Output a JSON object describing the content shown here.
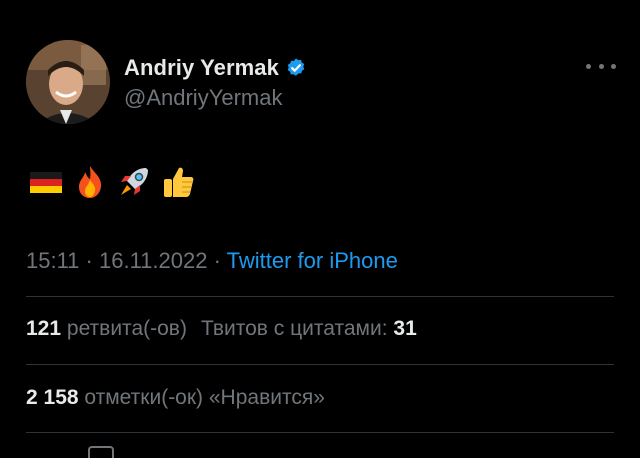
{
  "tweet": {
    "author": {
      "display_name": "Andriy Yermak",
      "handle": "@AndriyYermak",
      "verified": true
    },
    "emojis": [
      "german-flag",
      "fire",
      "rocket",
      "thumbs-up"
    ],
    "meta": {
      "time": "15:11",
      "date": "16.11.2022",
      "separator": "·",
      "source": "Twitter for iPhone"
    },
    "stats": {
      "retweets_count": "121",
      "retweets_label": "ретвита(-ов)",
      "quotes_label": "Твитов с цитатами:",
      "quotes_count": "31",
      "likes_count": "2 158",
      "likes_label": "отметки(-ок) «Нравится»"
    }
  },
  "colors": {
    "background": "#000000",
    "primary_text": "#e7e9ea",
    "secondary_text": "#71767b",
    "accent": "#1d9bf0",
    "divider": "#2f3336"
  }
}
